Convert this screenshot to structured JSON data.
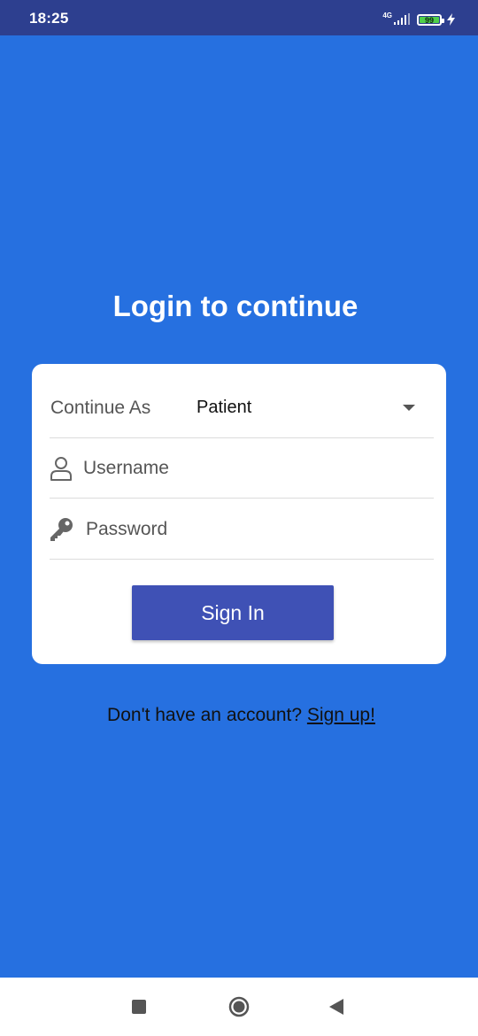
{
  "status_bar": {
    "time": "18:25",
    "network": "4G",
    "battery": "99"
  },
  "login": {
    "title": "Login to continue",
    "role_label": "Continue As",
    "role_value": "Patient",
    "username_placeholder": "Username",
    "password_placeholder": "Password",
    "signin_label": "Sign In"
  },
  "signup": {
    "prompt": "Don't have an account?",
    "link": "Sign up!"
  },
  "colors": {
    "background": "#2670e0",
    "status_bar": "#2d3f8f",
    "button": "#3f51b5",
    "battery": "#4fd04a"
  },
  "icons": {
    "username": "user-icon",
    "password": "key-icon",
    "dropdown": "dropdown-arrow-icon",
    "nav_recent": "square-icon",
    "nav_home": "circle-icon",
    "nav_back": "triangle-back-icon"
  }
}
